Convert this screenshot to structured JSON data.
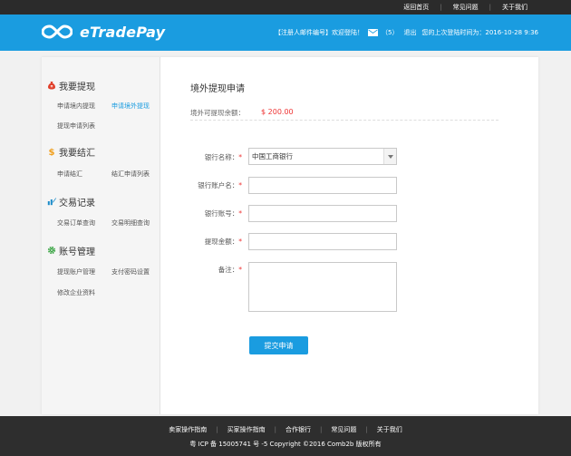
{
  "topbar": {
    "links": [
      "返回首页",
      "常见问题",
      "关于我们"
    ]
  },
  "header": {
    "logo_text": "eTradePay",
    "welcome": "【注册人邮件编号】欢迎登陆！",
    "message_count": "（5）",
    "logout": "退出",
    "last_login": "您的上次登陆时间为：2016-10-28  9:36"
  },
  "sidebar": {
    "groups": [
      {
        "title": "我要提现",
        "icon": "money-bag-icon",
        "items": [
          "申请境内提现",
          "申请境外提现",
          "提现申请列表"
        ]
      },
      {
        "title": "我要结汇",
        "icon": "dollar-icon",
        "items": [
          "申请结汇",
          "结汇申请列表"
        ]
      },
      {
        "title": "交易记录",
        "icon": "chart-edit-icon",
        "items": [
          "交易订单查询",
          "交易明细查询"
        ]
      },
      {
        "title": "账号管理",
        "icon": "gear-icon",
        "items": [
          "提现账户管理",
          "支付密码设置",
          "修改企业资料"
        ]
      }
    ]
  },
  "main": {
    "title": "境外提现申请",
    "balance_label": "境外可提现余额：",
    "balance_value": "$  200.00",
    "form": {
      "bank_name_label": "银行名称：",
      "bank_name_value": "中国工商银行",
      "account_name_label": "银行账户名：",
      "account_number_label": "银行账号：",
      "amount_label": "提现金额：",
      "remark_label": "备注：",
      "required_mark": "*",
      "submit_label": "提交申请"
    }
  },
  "footer": {
    "links": [
      "卖家操作指南",
      "买家操作指南",
      "合作银行",
      "常见问题",
      "关于我们"
    ],
    "copyright": "粤 ICP 备 15005741 号 -5 Copyright ©2016 Comb2b 版权所有"
  },
  "colors": {
    "brand_blue": "#1a9ce0",
    "top_bar": "#2b2b2b",
    "footer": "#2e2e2e",
    "required": "#e33333",
    "balance": "#e33333"
  }
}
